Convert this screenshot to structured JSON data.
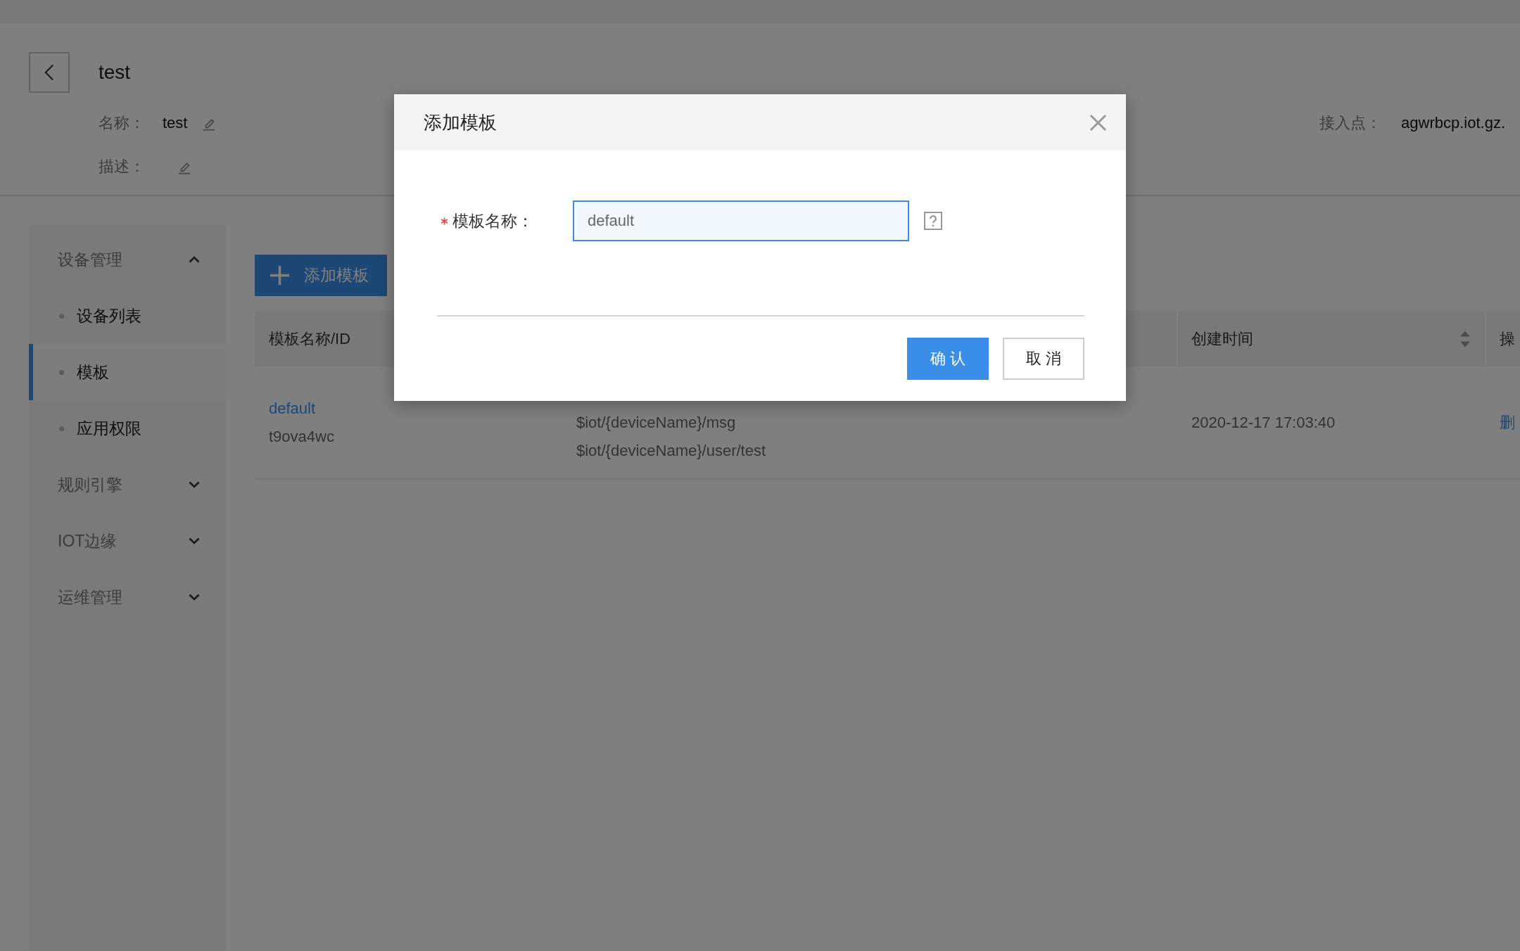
{
  "header": {
    "title": "test",
    "fields": [
      {
        "label": "名称：",
        "value": "test"
      },
      {
        "label": "描述："
      }
    ],
    "endpoint": {
      "label": "接入点：",
      "value": "agwrbcp.iot.gz."
    }
  },
  "sidebar": {
    "groups": [
      {
        "label": "设备管理",
        "expanded": true,
        "children": [
          {
            "label": "设备列表",
            "selected": false
          },
          {
            "label": "模板",
            "selected": true
          },
          {
            "label": "应用权限",
            "selected": false
          }
        ]
      },
      {
        "label": "规则引擎",
        "expanded": false
      },
      {
        "label": "IOT边缘",
        "expanded": false
      },
      {
        "label": "运维管理",
        "expanded": false
      }
    ]
  },
  "toolbar": {
    "add_button": "添加模板"
  },
  "table": {
    "columns": [
      {
        "label": "模板名称/ID",
        "sortable": false
      },
      {
        "label": "创建时间",
        "sortable": true
      },
      {
        "label": "操",
        "sortable": false
      }
    ],
    "rows": [
      {
        "name": "default",
        "id": "t9ova4wc",
        "topics": [
          "$iot/{deviceName}/msg",
          "$iot/{deviceName}/user/test"
        ],
        "created": "2020-12-17 17:03:40",
        "action": "删"
      }
    ]
  },
  "dialog": {
    "title": "添加模板",
    "fields": [
      {
        "label": "模板名称：",
        "required": true,
        "value": "default",
        "focused": true
      }
    ],
    "buttons": [
      {
        "label": "确 认",
        "kind": "primary"
      },
      {
        "label": "取 消",
        "kind": "default"
      }
    ]
  }
}
